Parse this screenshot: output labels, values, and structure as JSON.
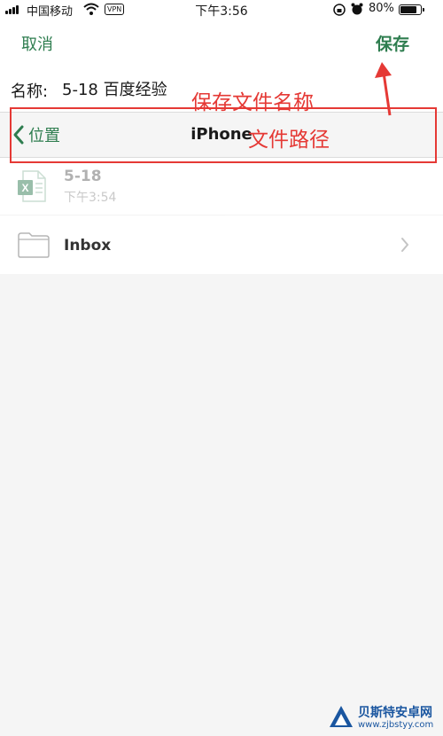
{
  "status_bar": {
    "carrier": "中国移动",
    "vpn": "VPN",
    "time": "下午3:56",
    "battery_percent": "80%",
    "battery_level": 0.8
  },
  "nav": {
    "cancel_label": "取消",
    "save_label": "保存"
  },
  "name_field": {
    "label": "名称:",
    "value": "5-18 百度经验"
  },
  "location": {
    "back_label": "位置",
    "title": "iPhone"
  },
  "files": [
    {
      "name": "5-18",
      "time": "下午3:54",
      "type": "excel"
    }
  ],
  "folders": [
    {
      "name": "Inbox"
    }
  ],
  "annotations": {
    "name_note": "保存文件名称",
    "path_note": "文件路径"
  },
  "watermark": {
    "title": "贝斯特安卓网",
    "url": "www.zjbstyy.com"
  },
  "colors": {
    "accent": "#2e7d4f",
    "annotation": "#e53935",
    "excel": "#1e7145"
  }
}
